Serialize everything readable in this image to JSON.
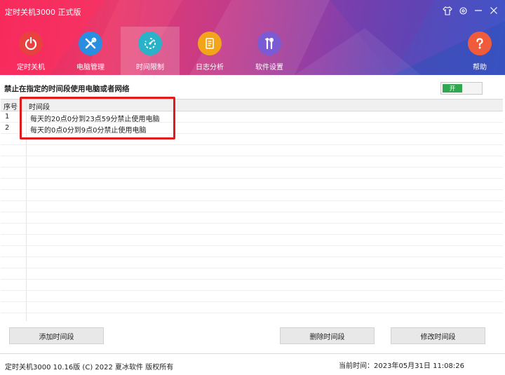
{
  "app": {
    "title": "定时关机3000 正式版"
  },
  "window_controls": [
    "skin-icon",
    "settings-icon",
    "minimize-icon",
    "close-icon"
  ],
  "nav": {
    "items": [
      {
        "label": "定时关机",
        "icon": "power-icon",
        "color": "#e8413f"
      },
      {
        "label": "电脑管理",
        "icon": "tools-icon",
        "color": "#2a8ee0"
      },
      {
        "label": "时间限制",
        "icon": "timer-icon",
        "color": "#29b2c8"
      },
      {
        "label": "日志分析",
        "icon": "log-icon",
        "color": "#f2a51a"
      },
      {
        "label": "软件设置",
        "icon": "settings-tools-icon",
        "color": "#7b5bd3"
      }
    ],
    "active_index": 2,
    "help_label": "帮助"
  },
  "section": {
    "title": "禁止在指定的时间段使用电脑或者网络",
    "toggle_label": "开"
  },
  "table": {
    "columns": [
      "序号",
      "时间段"
    ],
    "rows": [
      {
        "index": "1",
        "period": "每天的20点0分到23点59分禁止使用电脑"
      },
      {
        "index": "2",
        "period": "每天的0点0分到9点0分禁止使用电脑"
      }
    ]
  },
  "buttons": {
    "add": "添加时间段",
    "delete": "删除时间段",
    "edit": "修改时间段"
  },
  "footer": {
    "copyright": "定时关机3000 10.16版 (C) 2022  夏冰软件 版权所有",
    "current_time": "当前时间：2023年05月31日 11:08:26"
  },
  "colors": {
    "highlight": "#e01b1b",
    "toggle_on": "#2fa84f"
  }
}
